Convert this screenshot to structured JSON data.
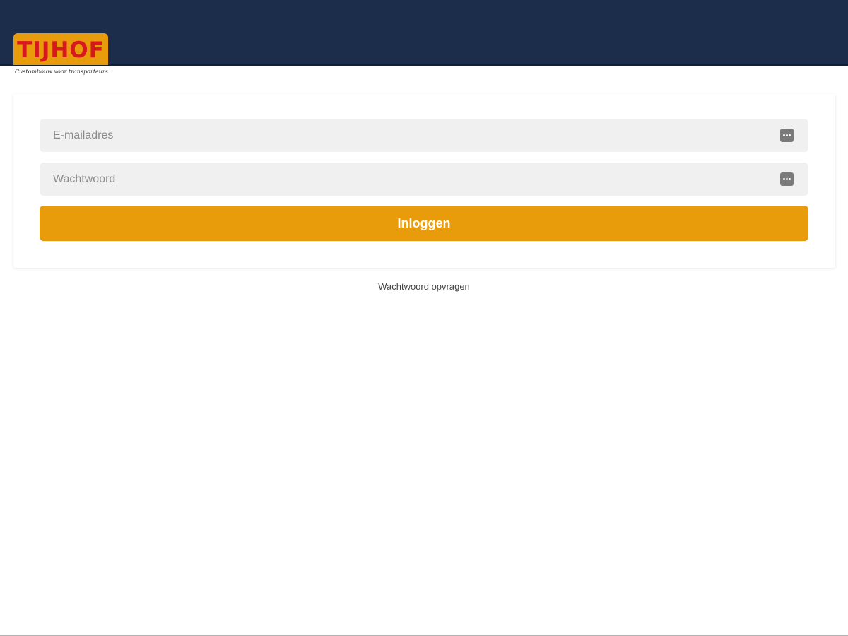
{
  "header": {
    "logo_text": "TIJHOF",
    "tagline": "Custombouw voor transporteurs",
    "background_color": "#1c2d4c",
    "logo_color": "#e89b0b",
    "logo_text_color": "#d7191f"
  },
  "login_form": {
    "email": {
      "placeholder": "E-mailadres",
      "value": "",
      "icon": "keychain-autofill-icon"
    },
    "password": {
      "placeholder": "Wachtwoord",
      "value": "",
      "icon": "keychain-autofill-icon"
    },
    "submit_label": "Inloggen",
    "accent_color": "#e89b0b"
  },
  "forgot_password_label": "Wachtwoord opvragen"
}
